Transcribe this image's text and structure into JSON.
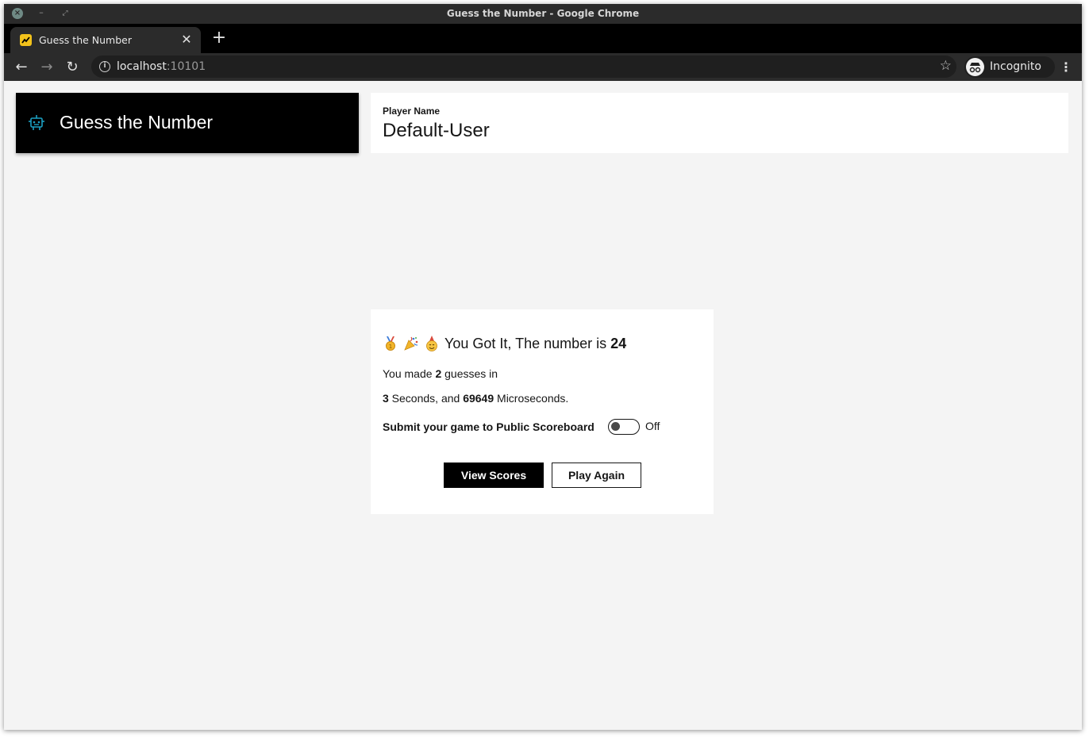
{
  "window": {
    "title": "Guess the Number - Google Chrome"
  },
  "tab": {
    "title": "Guess the Number",
    "close_glyph": "✕",
    "new_tab_glyph": "+"
  },
  "toolbar": {
    "back_glyph": "←",
    "forward_glyph": "→",
    "reload_glyph": "↻",
    "url_host": "localhost",
    "url_port": ":10101",
    "incognito_label": "Incognito",
    "menu_glyph": "⋮"
  },
  "header": {
    "brand_title": "Guess the Number",
    "player_label": "Player Name",
    "player_name": "Default-User"
  },
  "result": {
    "headline_prefix": "You Got It, The number is ",
    "number": "24",
    "line1_prefix": "You made ",
    "guesses": "2",
    "line1_suffix": " guesses in",
    "seconds": "3",
    "line2_mid": " Seconds, and ",
    "microseconds": "69649",
    "line2_suffix": " Microseconds.",
    "submit_label": "Submit your game to Public Scoreboard",
    "toggle_state": "Off",
    "view_scores_label": "View Scores",
    "play_again_label": "Play Again"
  },
  "colors": {
    "brand_bg": "#000000",
    "accent_icon": "#1ba1c4",
    "page_bg": "#f4f4f4"
  }
}
